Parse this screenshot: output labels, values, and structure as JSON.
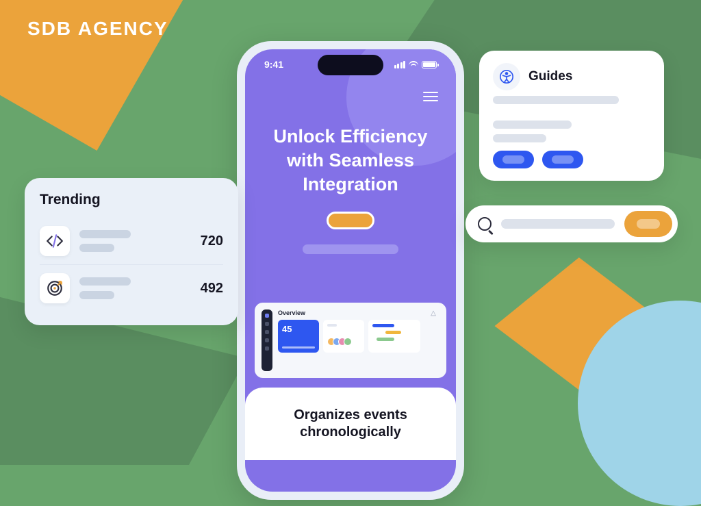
{
  "brand": {
    "logo": "SDB AGENCY"
  },
  "phone": {
    "time": "9:41",
    "hero_title": "Unlock Efficiency with Seamless Integration",
    "dashboard": {
      "label": "Overview",
      "stat": "45"
    },
    "sheet_title": "Organizes events chronologically"
  },
  "trending": {
    "title": "Trending",
    "rows": [
      {
        "icon": "code-icon",
        "value": "720"
      },
      {
        "icon": "target-icon",
        "value": "492"
      }
    ]
  },
  "guides": {
    "title": "Guides"
  },
  "search": {
    "placeholder": ""
  },
  "colors": {
    "green": "#68A56C",
    "orange": "#EBA33B",
    "purple": "#8371E7",
    "blue": "#2E57F0"
  }
}
